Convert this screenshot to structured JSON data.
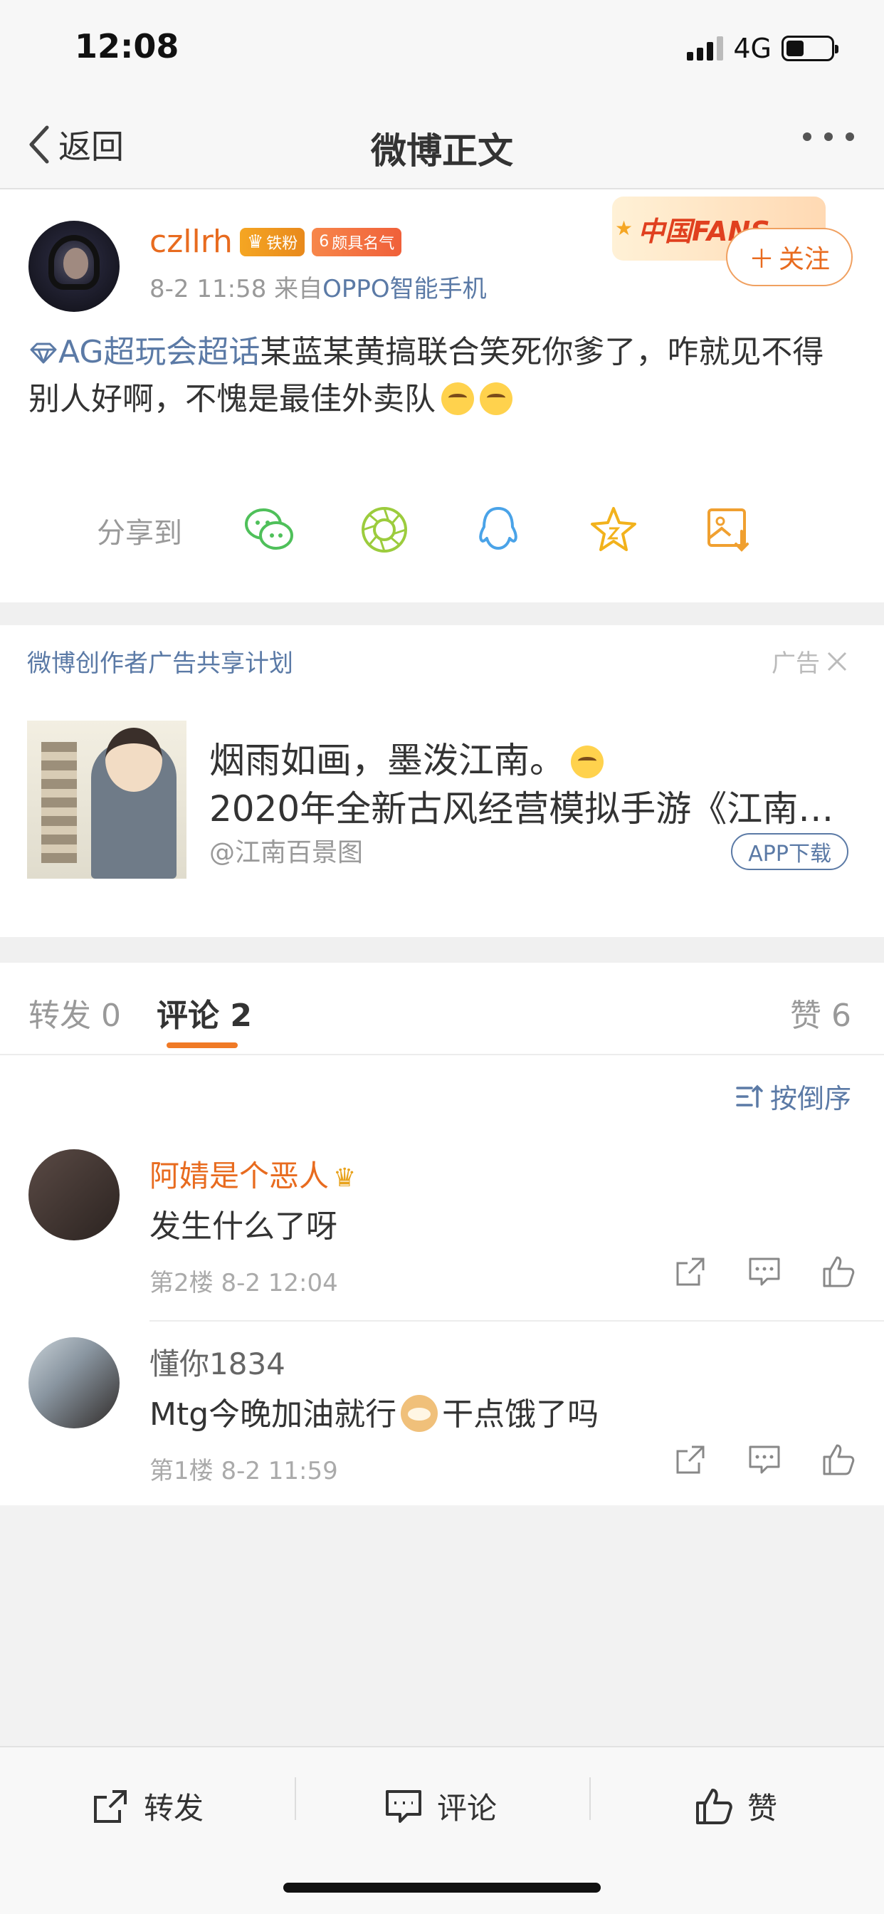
{
  "status": {
    "time": "12:08",
    "network": "4G"
  },
  "nav": {
    "back_label": "返回",
    "title": "微博正文"
  },
  "post": {
    "username": "czllrh",
    "badge_fan": "铁粉",
    "badge_level_num": "6",
    "badge_level_text": "颇具名气",
    "time": "8-2 11:58",
    "source_prefix": "来自",
    "source": "OPPO智能手机",
    "fans_banner": "中国FANS",
    "follow_label": "关注",
    "topic": "AG超玩会超话",
    "text": "某蓝某黄搞联合笑死你爹了，咋就见不得别人好啊，不愧是最佳外卖队"
  },
  "share": {
    "label": "分享到",
    "icons": [
      "wechat-icon",
      "moments-icon",
      "qq-icon",
      "favorite-icon",
      "save-image-icon"
    ]
  },
  "ad": {
    "header": "微博创作者广告共享计划",
    "tag": "广告",
    "line1": "烟雨如画，墨泼江南。",
    "line2": "2020年全新古风经营模拟手游《江南…",
    "source": "@江南百景图",
    "button": "APP下载"
  },
  "tabs": {
    "repost": "转发 0",
    "comment": "评论 2",
    "like": "赞 6"
  },
  "comments": {
    "sort_label": "按倒序",
    "items": [
      {
        "name": "阿婧是个恶人",
        "text": "发生什么了呀",
        "floor": "第2楼",
        "time": "8-2 12:04"
      },
      {
        "name": "懂你1834",
        "text_before": "Mtg今晚加油就行",
        "text_after": "干点饿了吗",
        "floor": "第1楼",
        "time": "8-2 11:59"
      }
    ]
  },
  "toolbar": {
    "repost": "转发",
    "comment": "评论",
    "like": "赞"
  },
  "colors": {
    "accent_orange": "#e86b1f",
    "link_blue": "#5b7aa6",
    "tab_underline": "#f07a26"
  }
}
